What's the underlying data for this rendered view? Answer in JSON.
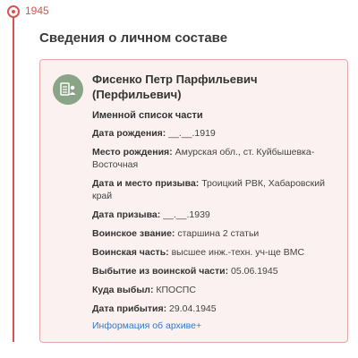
{
  "timeline": {
    "year": "1945"
  },
  "section": {
    "title": "Сведения о личном составе"
  },
  "person": {
    "name": "Фисенко Петр Парфильевич (Перфильевич)",
    "list_title": "Именной список части",
    "fields": [
      {
        "label": "Дата рождения:",
        "value": "__.__.1919"
      },
      {
        "label": "Место рождения:",
        "value": "Амурская обл., ст. Куйбышевка-Восточная"
      },
      {
        "label": "Дата и место призыва:",
        "value": "Троицкий РВК, Хабаровский край"
      },
      {
        "label": "Дата призыва:",
        "value": "__.__.1939"
      },
      {
        "label": "Воинское звание:",
        "value": "старшина 2 статьи"
      },
      {
        "label": "Воинская часть:",
        "value": "высшее инж.-техн. уч-ще ВМС"
      },
      {
        "label": "Выбытие из воинской части:",
        "value": "05.06.1945"
      },
      {
        "label": "Куда выбыл:",
        "value": "КПОСПС"
      },
      {
        "label": "Дата прибытия:",
        "value": "29.04.1945"
      }
    ],
    "archive_link": "Информация об архиве+"
  },
  "icons": {
    "avatar": "document-person-icon"
  },
  "colors": {
    "accent": "#d9534f",
    "avatar_bg": "#8aa487",
    "link": "#2f7bc8",
    "card_bg": "#fbf1f1"
  }
}
